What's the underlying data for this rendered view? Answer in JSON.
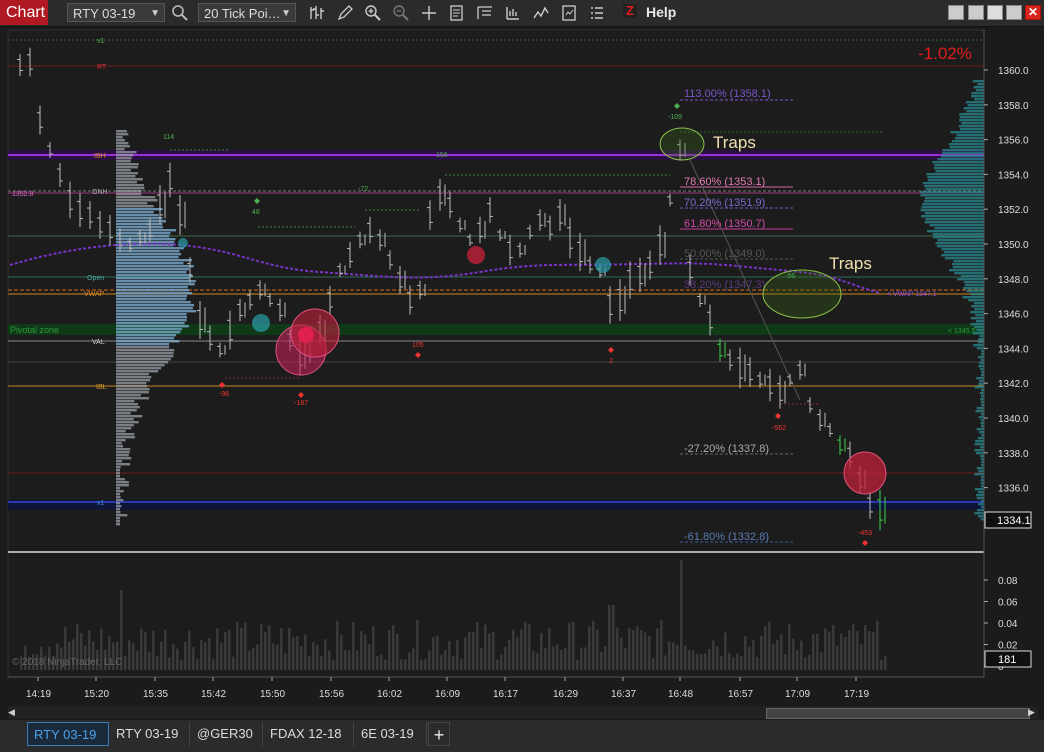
{
  "toolbar": {
    "title": "Chart",
    "instrument": "RTY 03-19",
    "bar_type": "20 Tick Poi…",
    "help": "Help",
    "z_logo": "Z",
    "icons": [
      "search-icon",
      "bar-style-icon",
      "draw-pencil-icon",
      "zoom-in-icon",
      "zoom-out-icon",
      "crosshair-icon",
      "data-box-icon",
      "properties-icon",
      "strategies-icon",
      "indicators-icon",
      "templates-icon",
      "list-icon"
    ],
    "window_buttons": [
      "restore-icon",
      "minimize-icon",
      "maximize-icon",
      "close-icon"
    ],
    "close_color": "#d9241c"
  },
  "chart": {
    "percent_change": "-1.02%",
    "copyright": "© 2018 NinjaTrader, LLC",
    "last_price": "1334.1",
    "volume_value": "181",
    "price_axis": [
      "1360.0",
      "1358.0",
      "1356.0",
      "1354.0",
      "1352.0",
      "1350.0",
      "1348.0",
      "1346.0",
      "1344.0",
      "1342.0",
      "1340.0",
      "1338.0",
      "1336.0"
    ],
    "volume_axis": [
      "0.08",
      "0.06",
      "0.04",
      "0.02",
      "0"
    ],
    "time_axis": [
      "14:19",
      "15:20",
      "15:35",
      "15:42",
      "15:50",
      "15:56",
      "16:02",
      "16:09",
      "16:17",
      "16:29",
      "16:37",
      "16:48",
      "16:57",
      "17:09",
      "17:19"
    ],
    "level_labels": {
      "x1_top": "x1",
      "rt": "RT",
      "ibh": "IBH",
      "price_1352": "1352.8",
      "onh": "ONH",
      "open": "Open",
      "vwap": "VWAP",
      "pivotal": "Pivotal zone",
      "val": "VAL",
      "ibl": "IBL",
      "x1_bottom": "x1",
      "vwap_right": "< VWAP 1347.1",
      "pivot_right": "< 1345.5"
    },
    "fib_labels": {
      "f113": "113.00% (1358.1)",
      "f786": "78.60% (1353.1)",
      "f702": "70.20% (1351.9)",
      "f618": "61.80% (1350.7)",
      "f50": "50.00% (1349.0)",
      "f38": "38.20% (1347.3)",
      "fm272": "-27.20% (1337.8)",
      "fm618": "-61.80% (1332.8)"
    },
    "annotations": {
      "traps1": "Traps",
      "traps2": "Traps"
    },
    "delta_labels": [
      "114",
      "48",
      "-72",
      "156",
      "-109",
      "-56",
      "-96",
      "-187",
      "105",
      "2",
      "-562",
      "-453"
    ],
    "colors": {
      "background": "#1b1b1b",
      "ibh_line": "#9b2fd6",
      "vwap_line": "#7a33c9",
      "pivot_zone": "#0e3d1a",
      "percent_text": "#e31b1b",
      "trap_ellipse": "#8bc34a",
      "price_box": "#101010"
    }
  },
  "tabs": [
    {
      "label": "RTY 03-19",
      "active": true
    },
    {
      "label": "RTY 03-19",
      "active": false
    },
    {
      "label": "@GER30",
      "active": false
    },
    {
      "label": "FDAX 12-18",
      "active": false
    },
    {
      "label": "6E 03-19",
      "active": false
    }
  ],
  "add_tab": "+"
}
